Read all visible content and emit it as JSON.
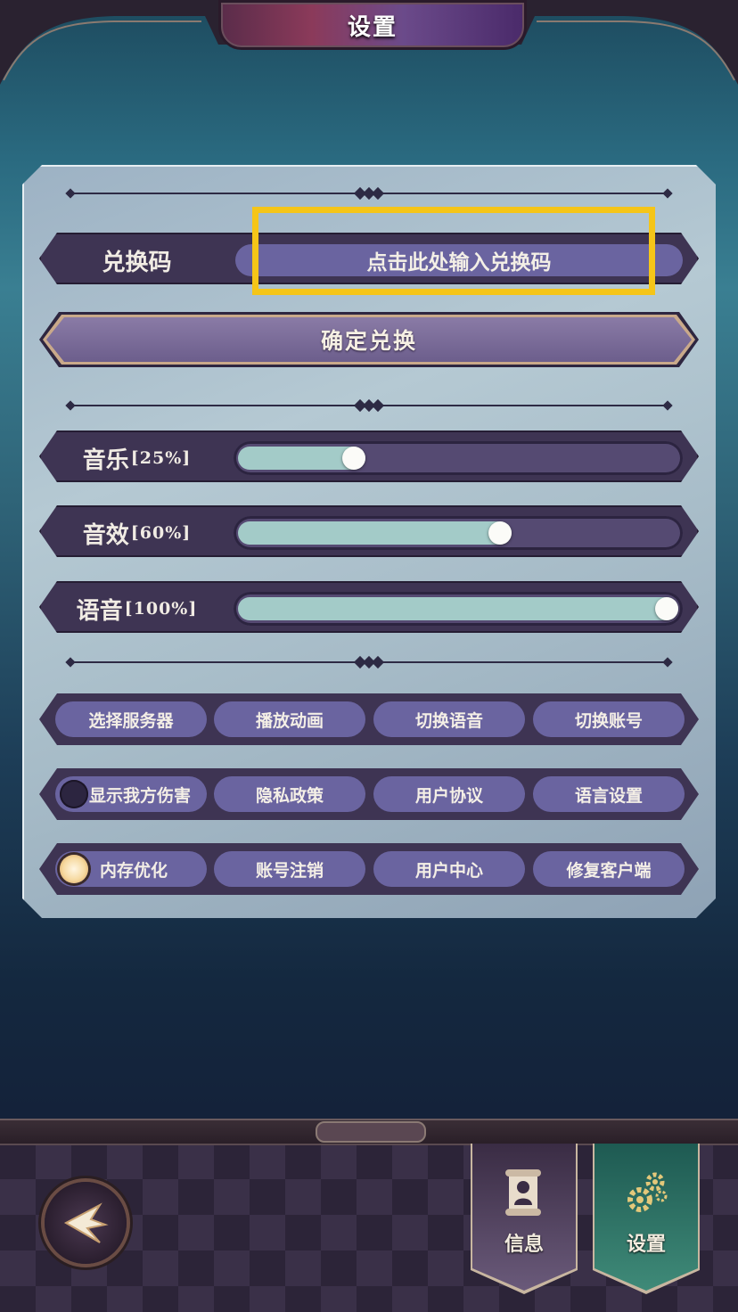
{
  "header": {
    "title": "设置"
  },
  "redeem": {
    "label": "兑换码",
    "placeholder": "点击此处输入兑换码",
    "confirm_label": "确定兑换"
  },
  "volume": [
    {
      "name": "音乐",
      "percent_text": "[25%]",
      "value": 25
    },
    {
      "name": "音效",
      "percent_text": "[60%]",
      "value": 60
    },
    {
      "name": "语音",
      "percent_text": "[100%]",
      "value": 100
    }
  ],
  "buttons": {
    "row1": [
      "选择服务器",
      "播放动画",
      "切换语音",
      "切换账号"
    ],
    "row2": [
      "显示我方伤害",
      "隐私政策",
      "用户协议",
      "语言设置"
    ],
    "row3": [
      "内存优化",
      "账号注销",
      "用户中心",
      "修复客户端"
    ]
  },
  "toggles": {
    "show_damage": false,
    "memory_optimize": true
  },
  "tabs": {
    "info": "信息",
    "settings": "设置",
    "active": "settings"
  },
  "colors": {
    "highlight": "#f5c518",
    "slider_fill": "#a3cbc8",
    "pill": "#6a64a0"
  }
}
